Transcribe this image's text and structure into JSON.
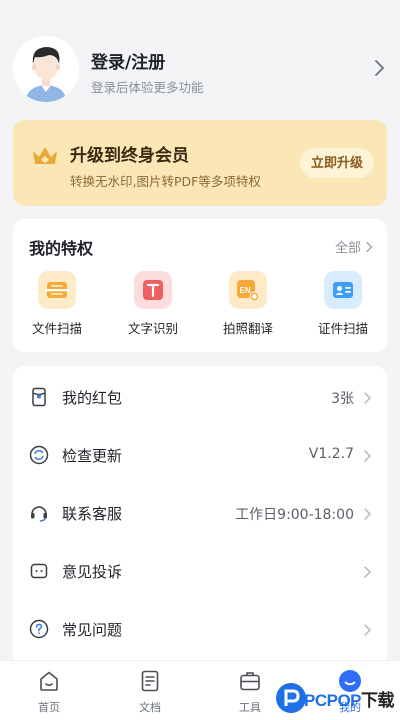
{
  "profile": {
    "title": "登录/注册",
    "subtitle": "登录后体验更多功能",
    "avatar_icon": "user-avatar-icon"
  },
  "vip": {
    "title": "升级到终身会员",
    "subtitle": "转换无水印,图片转PDF等多项特权",
    "button": "立即升级",
    "color_bg": "#fbe7b5",
    "color_icon": "#e8a93a"
  },
  "privileges": {
    "title": "我的特权",
    "all_label": "全部",
    "items": [
      {
        "label": "文件扫描",
        "icon": "file-scan-icon",
        "color": "#f7a935"
      },
      {
        "label": "文字识别",
        "icon": "text-recognition-icon",
        "color": "#ef5f5f"
      },
      {
        "label": "拍照翻译",
        "icon": "photo-translate-icon",
        "color": "#f7a935"
      },
      {
        "label": "证件扫描",
        "icon": "id-scan-icon",
        "color": "#3f9ef5"
      }
    ]
  },
  "menu": [
    {
      "label": "我的红包",
      "value": "3张",
      "icon": "red-packet-icon"
    },
    {
      "label": "检查更新",
      "value": "V1.2.7",
      "icon": "refresh-icon"
    },
    {
      "label": "联系客服",
      "value": "工作日9:00-18:00",
      "icon": "headset-icon"
    },
    {
      "label": "意见投诉",
      "value": "",
      "icon": "feedback-icon"
    },
    {
      "label": "常见问题",
      "value": "",
      "icon": "question-icon"
    }
  ],
  "tabs": [
    {
      "label": "首页",
      "icon": "home-icon",
      "active": false
    },
    {
      "label": "文档",
      "icon": "document-icon",
      "active": false
    },
    {
      "label": "工具",
      "icon": "toolbox-icon",
      "active": false
    },
    {
      "label": "我的",
      "icon": "profile-icon",
      "active": true
    }
  ],
  "watermark": {
    "text": "PCPOP",
    "suffix": "下载"
  },
  "colors": {
    "accent": "#2f6df6",
    "background": "#f3f4f6"
  }
}
